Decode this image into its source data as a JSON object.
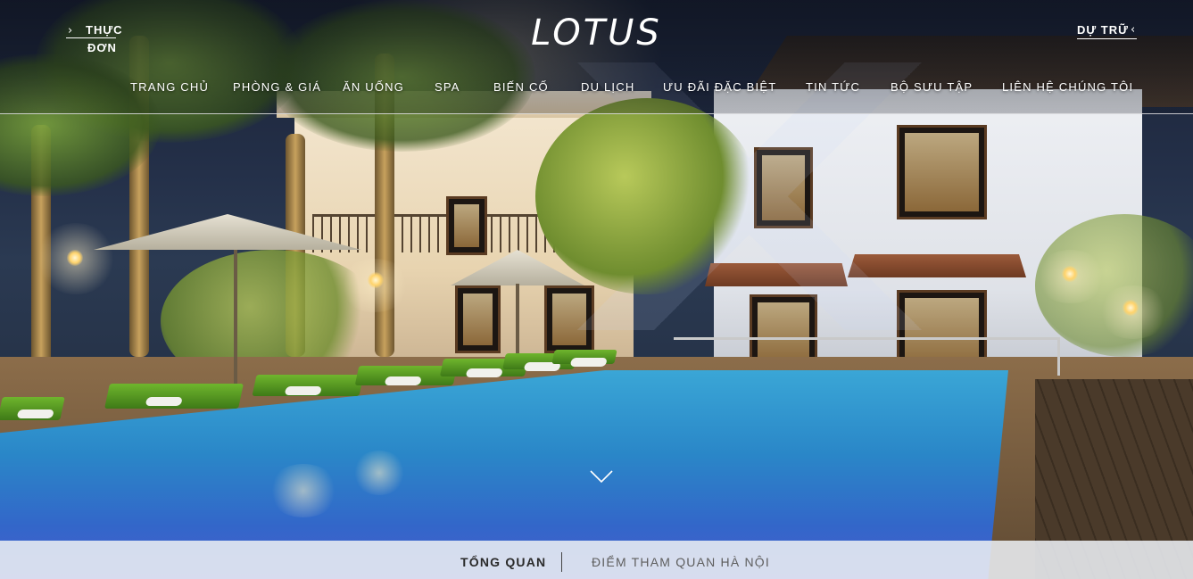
{
  "header": {
    "menu_line1": "THỰC",
    "menu_line2": "ĐƠN",
    "logo_text": "LOTUS",
    "reserve_label": "DỰ TRỮ"
  },
  "icons": {
    "menu_chevron": "chevron-right-icon",
    "reserve_chevron": "chevron-left-icon",
    "scroll_down": "chevron-down-icon"
  },
  "nav": {
    "items": [
      {
        "label": "TRANG CHỦ"
      },
      {
        "label": "PHÒNG & GIÁ"
      },
      {
        "label": "ĂN UỐNG"
      },
      {
        "label": "SPA"
      },
      {
        "label": "BIẾN CỐ"
      },
      {
        "label": "DU LỊCH"
      },
      {
        "label": "ƯU ĐÃI ĐẶC BIỆT"
      },
      {
        "label": "TIN TỨC"
      },
      {
        "label": "BỘ SƯU TẬP"
      },
      {
        "label": "LIÊN HỆ CHÚNG TÔI"
      }
    ]
  },
  "tabs": {
    "items": [
      {
        "label": "TỔNG QUAN",
        "active": true
      },
      {
        "label": "ĐIỂM THAM QUAN HÀ NỘI",
        "active": false
      }
    ]
  },
  "colors": {
    "tabbar_bg": "#ebeef2",
    "text_light": "#ffffff",
    "tab_active": "#2a2a2a",
    "tab_inactive": "#5e5e5e"
  }
}
